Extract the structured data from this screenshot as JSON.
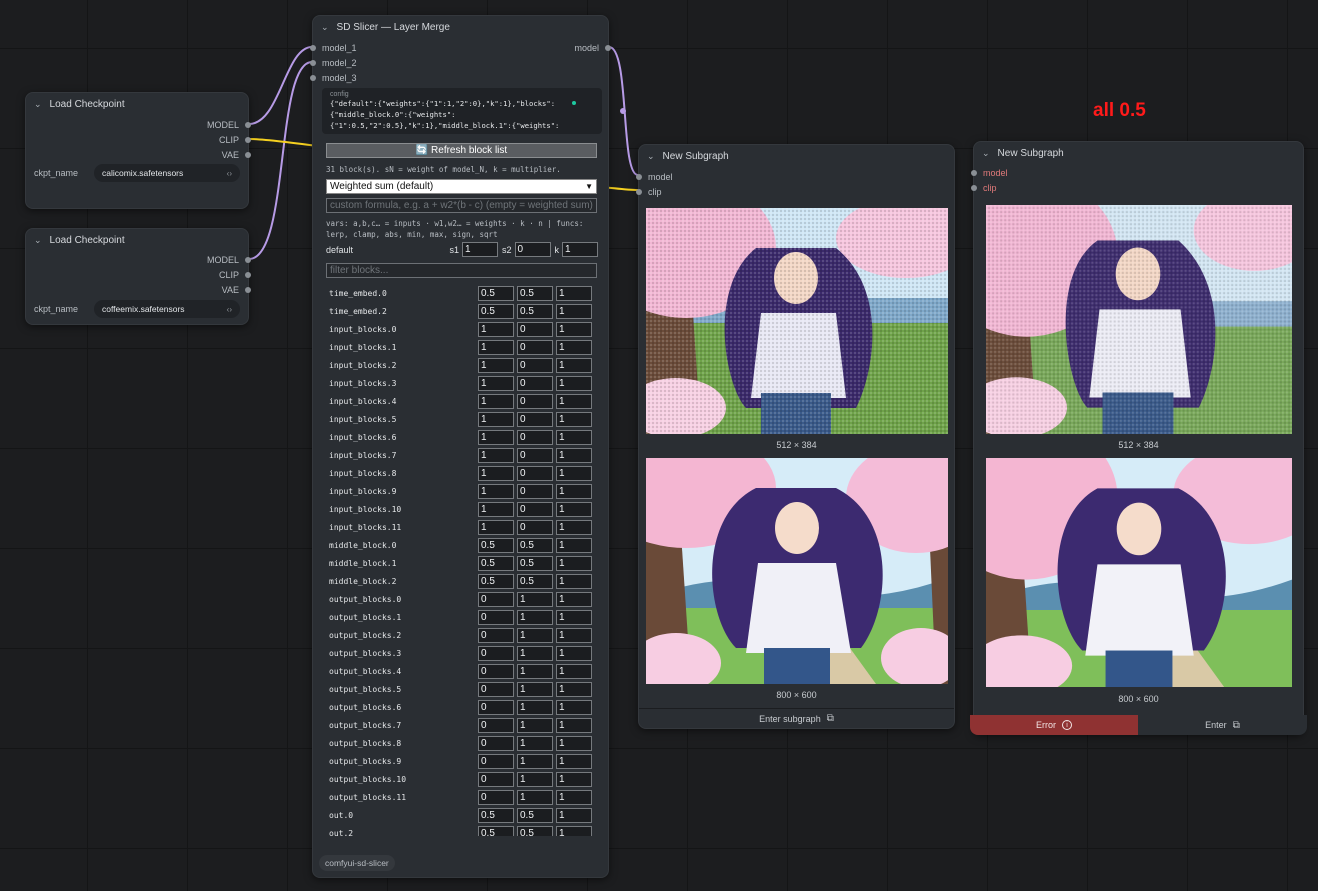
{
  "annotation": "all 0.5",
  "checkpoint1": {
    "title": "Load Checkpoint",
    "outputs": [
      "MODEL",
      "CLIP",
      "VAE"
    ],
    "widget_label": "ckpt_name",
    "widget_value": "calicomix.safetensors"
  },
  "checkpoint2": {
    "title": "Load Checkpoint",
    "outputs": [
      "MODEL",
      "CLIP",
      "VAE"
    ],
    "widget_label": "ckpt_name",
    "widget_value": "coffeemix.safetensors"
  },
  "slicer": {
    "title": "SD Slicer — Layer Merge",
    "inputs": [
      "model_1",
      "model_2",
      "model_3"
    ],
    "output": "model",
    "config_label": "config",
    "config_lines": [
      "{\"default\":{\"weights\":{\"1\":1,\"2\":0},\"k\":1},\"blocks\":",
      "{\"middle_block.0\":{\"weights\":",
      "{\"1\":0.5,\"2\":0.5},\"k\":1},\"middle_block.1\":{\"weights\":"
    ],
    "refresh_label": "🔄 Refresh block list",
    "summary": "31 block(s). sN = weight of model_N, k = multiplier.",
    "mode": "Weighted sum (default)",
    "formula_placeholder": "custom formula, e.g.  a + w2*(b - c)   (empty = weighted sum)",
    "vars_line1": "vars: a,b,c… = inputs · w1,w2… = weights · k · n | funcs:",
    "vars_line2": "lerp, clamp, abs, min, max, sign, sqrt",
    "default_label": "default",
    "s1_label": "s1",
    "s1": "1",
    "s2_label": "s2",
    "s2": "0",
    "k_label": "k",
    "k": "1",
    "filter_placeholder": "filter blocks...",
    "blocks": [
      {
        "name": "time_embed.0",
        "s1": "0.5",
        "s2": "0.5",
        "k": "1"
      },
      {
        "name": "time_embed.2",
        "s1": "0.5",
        "s2": "0.5",
        "k": "1"
      },
      {
        "name": "input_blocks.0",
        "s1": "1",
        "s2": "0",
        "k": "1"
      },
      {
        "name": "input_blocks.1",
        "s1": "1",
        "s2": "0",
        "k": "1"
      },
      {
        "name": "input_blocks.2",
        "s1": "1",
        "s2": "0",
        "k": "1"
      },
      {
        "name": "input_blocks.3",
        "s1": "1",
        "s2": "0",
        "k": "1"
      },
      {
        "name": "input_blocks.4",
        "s1": "1",
        "s2": "0",
        "k": "1"
      },
      {
        "name": "input_blocks.5",
        "s1": "1",
        "s2": "0",
        "k": "1"
      },
      {
        "name": "input_blocks.6",
        "s1": "1",
        "s2": "0",
        "k": "1"
      },
      {
        "name": "input_blocks.7",
        "s1": "1",
        "s2": "0",
        "k": "1"
      },
      {
        "name": "input_blocks.8",
        "s1": "1",
        "s2": "0",
        "k": "1"
      },
      {
        "name": "input_blocks.9",
        "s1": "1",
        "s2": "0",
        "k": "1"
      },
      {
        "name": "input_blocks.10",
        "s1": "1",
        "s2": "0",
        "k": "1"
      },
      {
        "name": "input_blocks.11",
        "s1": "1",
        "s2": "0",
        "k": "1"
      },
      {
        "name": "middle_block.0",
        "s1": "0.5",
        "s2": "0.5",
        "k": "1"
      },
      {
        "name": "middle_block.1",
        "s1": "0.5",
        "s2": "0.5",
        "k": "1"
      },
      {
        "name": "middle_block.2",
        "s1": "0.5",
        "s2": "0.5",
        "k": "1"
      },
      {
        "name": "output_blocks.0",
        "s1": "0",
        "s2": "1",
        "k": "1"
      },
      {
        "name": "output_blocks.1",
        "s1": "0",
        "s2": "1",
        "k": "1"
      },
      {
        "name": "output_blocks.2",
        "s1": "0",
        "s2": "1",
        "k": "1"
      },
      {
        "name": "output_blocks.3",
        "s1": "0",
        "s2": "1",
        "k": "1"
      },
      {
        "name": "output_blocks.4",
        "s1": "0",
        "s2": "1",
        "k": "1"
      },
      {
        "name": "output_blocks.5",
        "s1": "0",
        "s2": "1",
        "k": "1"
      },
      {
        "name": "output_blocks.6",
        "s1": "0",
        "s2": "1",
        "k": "1"
      },
      {
        "name": "output_blocks.7",
        "s1": "0",
        "s2": "1",
        "k": "1"
      },
      {
        "name": "output_blocks.8",
        "s1": "0",
        "s2": "1",
        "k": "1"
      },
      {
        "name": "output_blocks.9",
        "s1": "0",
        "s2": "1",
        "k": "1"
      },
      {
        "name": "output_blocks.10",
        "s1": "0",
        "s2": "1",
        "k": "1"
      },
      {
        "name": "output_blocks.11",
        "s1": "0",
        "s2": "1",
        "k": "1"
      },
      {
        "name": "out.0",
        "s1": "0.5",
        "s2": "0.5",
        "k": "1"
      },
      {
        "name": "out.2",
        "s1": "0.5",
        "s2": "0.5",
        "k": "1"
      }
    ],
    "badge": "comfyui-sd-slicer"
  },
  "subgraph1": {
    "title": "New Subgraph",
    "inputs": [
      "model",
      "clip"
    ],
    "image1_size": "512 × 384",
    "image2_size": "800 × 600",
    "footer": "Enter subgraph"
  },
  "subgraph2": {
    "title": "New Subgraph",
    "inputs": [
      "model",
      "clip"
    ],
    "image1_size": "512 × 384",
    "image2_size": "800 × 600",
    "error_label": "Error",
    "enter_label": "Enter"
  },
  "colors": {
    "model_wire": "#b79be6",
    "clip_wire": "#f5d020",
    "error_bg": "#8f3232",
    "annotation": "#ff1a1a"
  }
}
